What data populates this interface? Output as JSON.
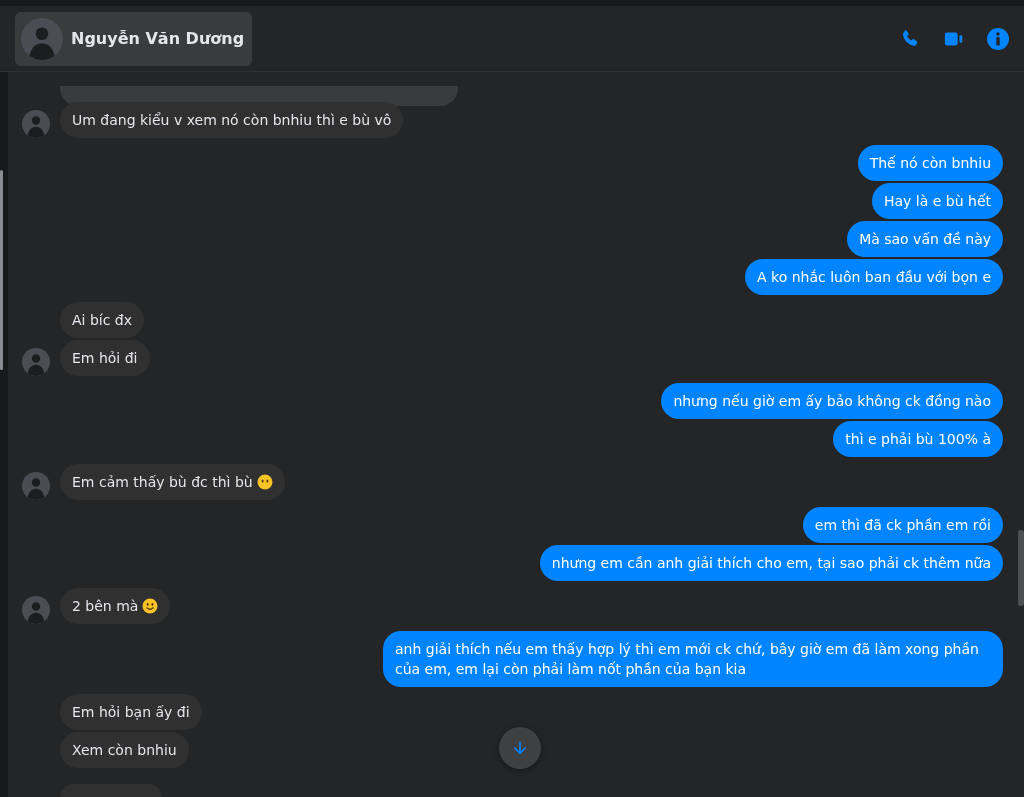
{
  "header": {
    "contact_name": "Nguyễn Văn Dương"
  },
  "groups": [
    {
      "kind": "incoming",
      "messages": [
        {
          "kind": "cut-top"
        },
        {
          "kind": "text",
          "text": "Um đang kiểu v xem nó còn bnhiu thì e bù vô"
        }
      ]
    },
    {
      "kind": "outgoing",
      "messages": [
        {
          "kind": "text",
          "text": "Thế nó còn bnhiu"
        },
        {
          "kind": "text",
          "text": "Hay là e bù hết"
        },
        {
          "kind": "text",
          "text": "Mà sao vấn đề này"
        },
        {
          "kind": "text",
          "text": "A ko nhắc luôn ban đầu với bọn e"
        }
      ]
    },
    {
      "kind": "incoming",
      "messages": [
        {
          "kind": "text",
          "text": "Ai bíc đx"
        },
        {
          "kind": "text",
          "text": "Em hỏi đi"
        }
      ]
    },
    {
      "kind": "outgoing",
      "messages": [
        {
          "kind": "text",
          "text": "nhưng nếu giờ em ấy bảo không ck đồng nào"
        },
        {
          "kind": "text",
          "text": "thì e phải bù 100% à"
        }
      ]
    },
    {
      "kind": "incoming",
      "messages": [
        {
          "kind": "text-with-blank-face",
          "text": "Em cảm thấy bù đc thì bù"
        }
      ]
    },
    {
      "kind": "outgoing",
      "messages": [
        {
          "kind": "text",
          "text": "em thì đã ck phần em rồi"
        },
        {
          "kind": "text",
          "text": "nhưng em cần anh giải thích cho em, tại sao phải ck thêm nữa"
        }
      ]
    },
    {
      "kind": "incoming",
      "messages": [
        {
          "kind": "text-with-smile",
          "text": "2 bên mà"
        }
      ]
    },
    {
      "kind": "outgoing",
      "messages": [
        {
          "kind": "text",
          "text": "anh giải thích nếu em thấy hợp lý thì em mới ck chứ, bây giờ em đã làm xong phần của em, em lại còn phải làm nốt phần của bạn kia"
        }
      ]
    },
    {
      "kind": "incoming",
      "messages": [
        {
          "kind": "text",
          "text": "Em hỏi bạn ấy đi"
        },
        {
          "kind": "text",
          "text": "Xem còn bnhiu"
        },
        {
          "kind": "cut-bottom"
        }
      ]
    }
  ]
}
